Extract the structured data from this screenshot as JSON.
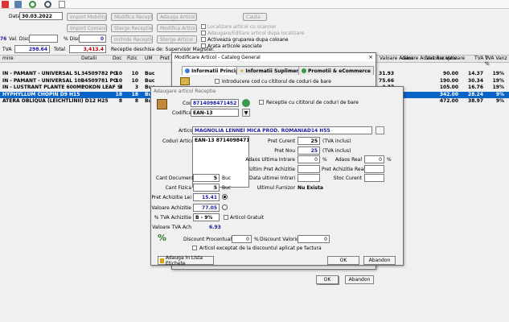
{
  "toolbar": {
    "date_label": "Data",
    "date_value": "30.03.2022",
    "val_disc_label": "Val. Disc.",
    "pct_disc_label": "% Disc.",
    "pct_disc_value": "0",
    "tva_label": "TVA",
    "tva_value": "298.64",
    "total_label": "Total",
    "total_value": "3,413.4",
    "left_num": "76",
    "receptie_note": "Receptie deschisa de: Supervisor Magister.",
    "buttons": {
      "import_mobility": "Import Mobility",
      "import_comanda": "Import Comanda",
      "import_receptie": "Import Receptie",
      "modifica_receptie": "Modifica Receptie",
      "sterge_receptie": "Sterge Receptie",
      "inchide_receptie": "Inchide Receptie",
      "adauga_articol": "Adauga Articol",
      "modifica_articol": "Modifica Articol",
      "sterge_articol": "Sterge Articol",
      "cauta": "Cauta"
    },
    "options": {
      "opt1": "Localizare articol cu scanner",
      "opt2": "Adaugare/Editare articol dupa localizare",
      "opt3": "Activeaza gruparea dupa coloane",
      "opt4": "Arata articole asociate"
    }
  },
  "grid": {
    "headers": [
      "mire",
      "Detalii",
      "Doc",
      "Fizic",
      "UM",
      "Pret"
    ],
    "right_headers": [
      "Valoare Adaos",
      "Valoare Adaos Receptie",
      "Valoare Vanzare",
      "TVA V",
      "TVA Vanz %"
    ],
    "rows": [
      {
        "name": "IN - PAMANT - UNIVERSAL 5L",
        "code": "34509782 PO",
        "doc": "10",
        "fizic": "10",
        "um": "Buc",
        "adaos": "31.93",
        "vanzare": "90.00",
        "tva": "14.37",
        "tvap": "19%"
      },
      {
        "name": "IN - PAMANT - UNIVERSAL 10L",
        "code": "34509781 PO",
        "doc": "10",
        "fizic": "10",
        "um": "Buc",
        "adaos": "75.66",
        "vanzare": "190.00",
        "tva": "30.34",
        "tvap": "19%"
      },
      {
        "name": "IN - LUSTRANT PLANTE 600ML",
        "code": "POKON LEAF SI",
        "doc": "3",
        "fizic": "3",
        "um": "Buc",
        "adaos": "2.77",
        "vanzare": "105.00",
        "tva": "16.76",
        "tvap": "19%"
      },
      {
        "name": "HYPHYLLUM CHOPIN D9 H15",
        "code": "",
        "doc": "18",
        "fizic": "18",
        "um": "Buc",
        "adaos": "101.54",
        "vanzare": "342.00",
        "tva": "28.24",
        "tvap": "9%"
      },
      {
        "name": "ATERA OBLIQUA (LEICHTLINII) D12 H25",
        "code": "",
        "doc": "8",
        "fizic": "8",
        "um": "Buc",
        "adaos": "29.15",
        "vanzare": "472.00",
        "tva": "38.97",
        "tvap": "9%"
      }
    ]
  },
  "modifica_window": {
    "title": "Modificare Articol - Catalog General",
    "close": "×",
    "tabs": [
      "Informatii Principale",
      "Informatii Suplimentare",
      "Promotii & eCommerce"
    ],
    "intro_cod": "Introducere cod cu cititorul de coduri de bare",
    "ok": "OK",
    "abandon": "Abandon"
  },
  "adaugare_dialog": {
    "title": "Adaugare articol Receptie",
    "cod_label": "Cod",
    "cod_value": "8714098471452",
    "codificare_label": "Codificare",
    "codificare_value": "EAN-13",
    "receptie_cod_bare": "Receptie cu cititorul de coduri de bare",
    "articol_label": "Articol",
    "articol_value": "MAGNOLIA LENNEI MICA PROD. ROMANIAD14 H55",
    "coduri_label": "Coduri Articol",
    "coduri_value": "EAN-13   8714098471452",
    "pret_curent_label": "Pret Curent",
    "pret_curent_value": "25",
    "pret_nou_label": "Pret Nou",
    "pret_nou_value": "25",
    "tva_inclus": "(TVA inclus)",
    "adaos_ultima_label": "Adaos Ultima Intrare",
    "adaos_ultima_value": "0",
    "adaos_real_label": "Adaos Real",
    "adaos_real_value": "0",
    "pct": "%",
    "ultim_pret_label": "Ultim Pret Achizitie",
    "pret_achizitie_real_label": "Pret Achizitie Real",
    "data_ultimei_label": "Data ultimei Intrari",
    "stoc_curent_label": "Stoc Curent",
    "ultimul_furnizor_label": "Ultimul Furnizor",
    "ultimul_furnizor_value": "Nu Exista",
    "cant_doc_label": "Cant Document",
    "cant_doc_value": "5",
    "cant_fizic_label": "Cant Fizica",
    "cant_fizic_value": "5",
    "buc": "Buc",
    "pret_achizitie_lei_label": "Pret Achizitie Lei",
    "pret_achizitie_lei_value": "15.41",
    "valoare_achizitie_label": "Valoare Achizitie",
    "valoare_achizitie_value": "77.05",
    "tva_achizitie_label": "% TVA Achizitie",
    "tva_achizitie_value": "B - 9%",
    "articol_gratuit": "Articol Gratuit",
    "valoare_tva_label": "Valoare TVA Ach",
    "valoare_tva_value": "6.93",
    "discount_procentual_label": "Discount Procentual",
    "discount_procentual_value": "0",
    "discount_valoric_label": "Discount Valoric",
    "discount_valoric_value": "0",
    "articol_exceptat": "Articol exceptat de la discountul aplicat pe factura",
    "adauga_lista": "Adauga in Lista Etichete",
    "ok": "OK",
    "abandon": "Abandon"
  },
  "colors": {
    "selection": "#0a64c8",
    "link_blue": "#1a1aa0",
    "total_red": "#c00000"
  }
}
